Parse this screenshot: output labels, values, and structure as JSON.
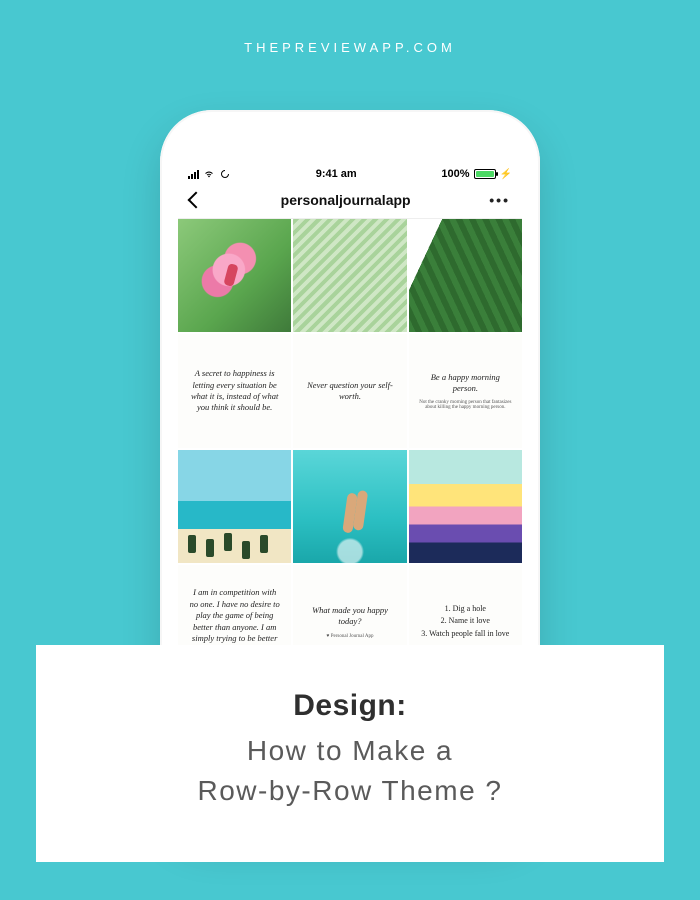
{
  "brand": "THEPREVIEWAPP.COM",
  "phone": {
    "status": {
      "time": "9:41 am",
      "battery_label": "100%"
    },
    "nav": {
      "title": "personaljournalapp",
      "more": "•••"
    },
    "grid": {
      "row1": [
        {
          "type": "photo",
          "name": "hibiscus-flower"
        },
        {
          "type": "photo",
          "name": "palm-frond"
        },
        {
          "type": "photo",
          "name": "banana-leaf"
        }
      ],
      "row2": [
        {
          "type": "quote",
          "text": "A secret to happiness is letting every situation be what it is, instead of what you think it should be."
        },
        {
          "type": "quote",
          "text": "Never question your self-worth."
        },
        {
          "type": "quote",
          "text": "Be a happy morning person.",
          "sub": "Not the cranky morning person that fantasizes about killing the happy morning person."
        }
      ],
      "row3": [
        {
          "type": "photo",
          "name": "tropical-beach"
        },
        {
          "type": "photo",
          "name": "feet-in-lagoon"
        },
        {
          "type": "photo",
          "name": "ocean-sunset"
        }
      ],
      "row4": [
        {
          "type": "quote",
          "text": "I am in competition with no one. I have no desire to play the game of being better than anyone. I am simply trying to be better than the person I was"
        },
        {
          "type": "quote",
          "text": "What made you happy today?",
          "sub": "♥ Personal Journal App"
        },
        {
          "type": "list",
          "l1": "1. Dig a hole",
          "l2": "2. Name it love",
          "l3": "3. Watch people fall in love"
        }
      ]
    }
  },
  "caption": {
    "heading": "Design:",
    "sub_line1": "How to Make a",
    "sub_line2": "Row-by-Row Theme ?"
  }
}
